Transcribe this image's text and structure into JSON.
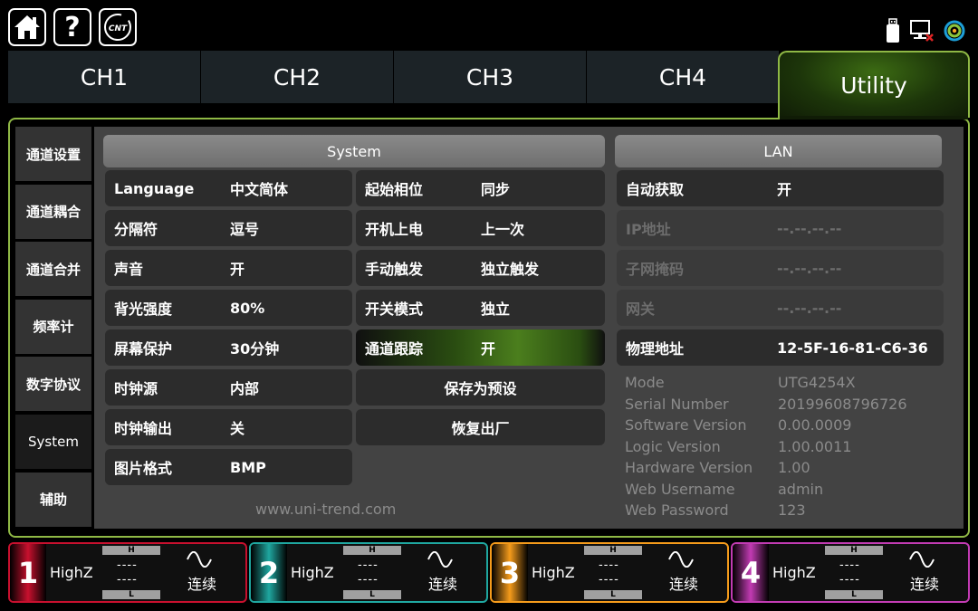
{
  "top_bar": {
    "home_icon": "home-icon",
    "help_label": "?",
    "cnt_label": "CNT",
    "status_icons": [
      "usb-drive-icon",
      "network-disconnected-icon",
      "uni-trend-logo-icon"
    ]
  },
  "tabs": [
    {
      "label": "CH1",
      "active": false
    },
    {
      "label": "CH2",
      "active": false
    },
    {
      "label": "CH3",
      "active": false
    },
    {
      "label": "CH4",
      "active": false
    },
    {
      "label": "Utility",
      "active": true
    }
  ],
  "sidebar": [
    {
      "label": "通道设置"
    },
    {
      "label": "通道耦合"
    },
    {
      "label": "通道合并"
    },
    {
      "label": "频率计"
    },
    {
      "label": "数字协议"
    },
    {
      "label": "System",
      "active": true
    },
    {
      "label": "辅助"
    }
  ],
  "system": {
    "header": "System",
    "left": [
      {
        "label": "Language",
        "value": "中文简体"
      },
      {
        "label": "分隔符",
        "value": "逗号"
      },
      {
        "label": "声音",
        "value": "开"
      },
      {
        "label": "背光强度",
        "value": "80%"
      },
      {
        "label": "屏幕保护",
        "value": "30分钟"
      },
      {
        "label": "时钟源",
        "value": "内部"
      },
      {
        "label": "时钟输出",
        "value": "关"
      },
      {
        "label": "图片格式",
        "value": "BMP"
      }
    ],
    "right": [
      {
        "label": "起始相位",
        "value": "同步"
      },
      {
        "label": "开机上电",
        "value": "上一次"
      },
      {
        "label": "手动触发",
        "value": "独立触发"
      },
      {
        "label": "开关模式",
        "value": "独立"
      },
      {
        "label": "通道跟踪",
        "value": "开"
      }
    ],
    "buttons": [
      "保存为预设",
      "恢复出厂"
    ],
    "website": "www.uni-trend.com"
  },
  "lan": {
    "header": "LAN",
    "rows": [
      {
        "label": "自动获取",
        "value": "开"
      },
      {
        "label": "IP地址",
        "value": "--.--.--.--"
      },
      {
        "label": "子网掩码",
        "value": "--.--.--.--"
      },
      {
        "label": "网关",
        "value": "--.--.--.--"
      },
      {
        "label": "物理地址",
        "value": "12-5F-16-81-C6-36"
      }
    ],
    "info": [
      {
        "label": "Mode",
        "value": "UTG4254X"
      },
      {
        "label": "Serial Number",
        "value": "20199608796726"
      },
      {
        "label": "Software Version",
        "value": "0.00.0009"
      },
      {
        "label": "Logic Version",
        "value": "1.00.0011"
      },
      {
        "label": "Hardware Version",
        "value": "1.00"
      },
      {
        "label": "Web Username",
        "value": "admin"
      },
      {
        "label": "Web Password",
        "value": "123"
      }
    ]
  },
  "channels": [
    {
      "num": "1",
      "load": "HighZ",
      "h": "H",
      "l": "L",
      "high": "----",
      "low": "----",
      "mode": "连续",
      "color": "#c8102e"
    },
    {
      "num": "2",
      "load": "HighZ",
      "h": "H",
      "l": "L",
      "high": "----",
      "low": "----",
      "mode": "连续",
      "color": "#1fa7a0"
    },
    {
      "num": "3",
      "load": "HighZ",
      "h": "H",
      "l": "L",
      "high": "----",
      "low": "----",
      "mode": "连续",
      "color": "#f59b1b"
    },
    {
      "num": "4",
      "load": "HighZ",
      "h": "H",
      "l": "L",
      "high": "----",
      "low": "----",
      "mode": "连续",
      "color": "#c23bb3"
    }
  ]
}
